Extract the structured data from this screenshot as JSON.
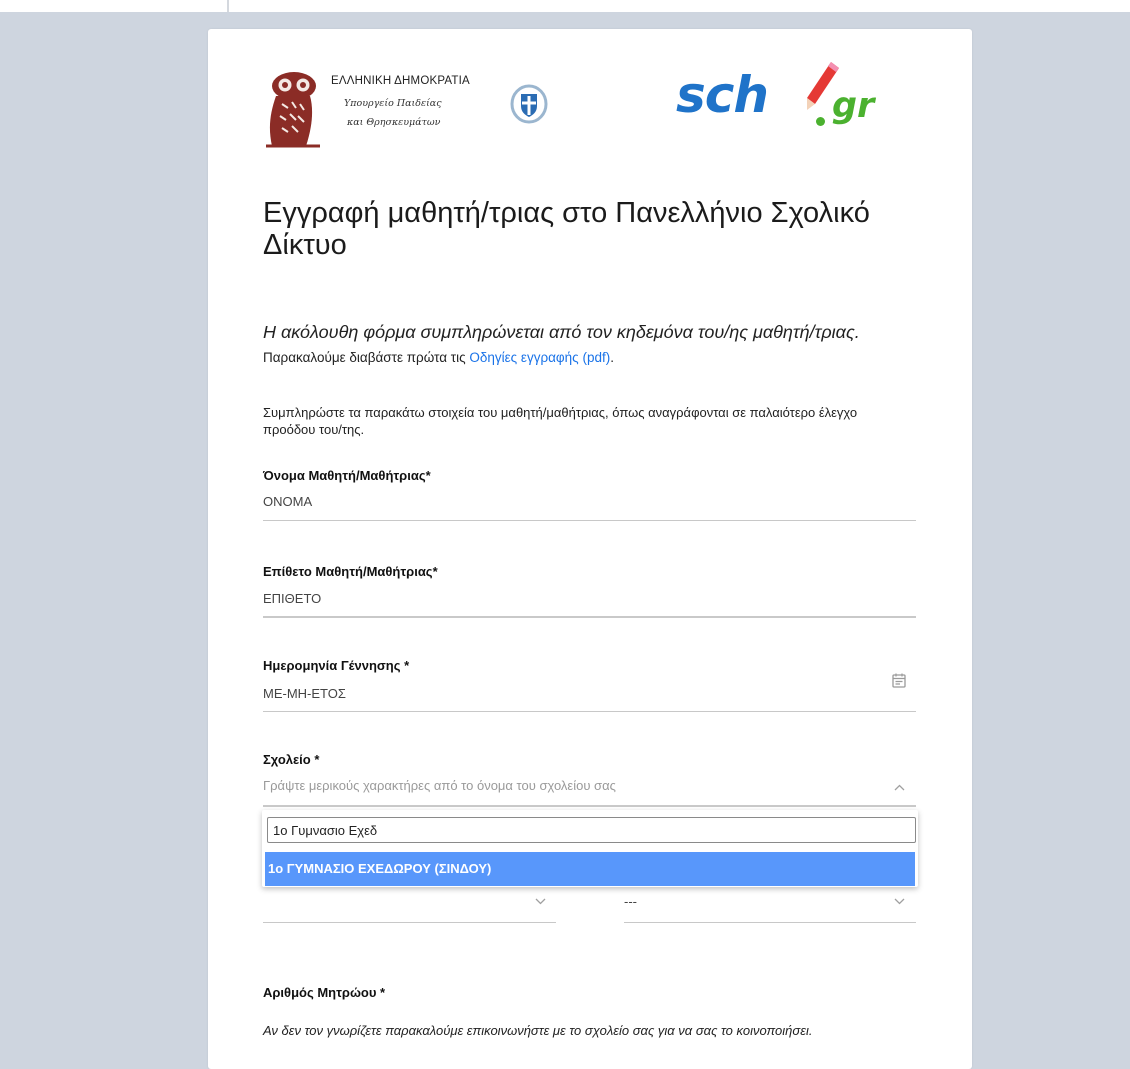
{
  "header": {
    "ministry_line1": "ΕΛΛΗΝΙΚΗ ΔΗΜΟΚΡΑΤΙΑ",
    "ministry_line2": "Υπουργείο Παιδείας",
    "ministry_line3": "και Θρησκευμάτων",
    "portal_logo_main": "sch",
    "portal_logo_suffix": "gr"
  },
  "page": {
    "title": "Εγγραφή μαθητή/τριας στο Πανελλήνιο Σχολικό Δίκτυο",
    "intro_italic": "Η ακόλουθη φόρμα συμπληρώνεται από τον κηδεμόνα του/ης μαθητή/τριας.",
    "intro_plain": " Παρακαλούμε διαβάστε πρώτα τις ",
    "intro_link": "Οδηγίες εγγραφής (pdf)",
    "intro_end": ".",
    "fill_note": "Συμπληρώστε τα παρακάτω στοιχεία του μαθητή/μαθήτριας, όπως αναγράφονται σε παλαιότερο έλεγχο προόδου του/της."
  },
  "form": {
    "first_name": {
      "label": "Όνομα Μαθητή/Μαθήτριας*",
      "value": "ΟΝΟΜΑ"
    },
    "last_name": {
      "label": "Επίθετο Μαθητή/Μαθήτριας*",
      "value": "ΕΠΙΘΕΤΟ"
    },
    "birth_date": {
      "label": "Ημερομηνία Γέννησης *",
      "value": "ΜΕ-ΜΗ-ΕΤΟΣ"
    },
    "school": {
      "label": "Σχολείο *",
      "placeholder": "Γράψτε μερικούς χαρακτήρες από το όνομα του σχολείου σας",
      "search_value": "1ο Γυμνασιο Εχεδ",
      "highlighted_option": "1ο ΓΥΜΝΑΣΙΟ ΕΧΕΔΩΡΟΥ (ΣΙΝΔΟΥ)"
    },
    "second_select_value": "---",
    "registry_number": {
      "label": "Αριθμός Μητρώου *",
      "help": "Αν δεν τον γνωρίζετε παρακαλούμε επικοινωνήστε με το σχολείο σας για να σας το κοινοποιήσει."
    }
  },
  "colors": {
    "page_background": "#ced5df",
    "link": "#1a73e8",
    "highlight": "#5897fb",
    "logo_blue": "#1f73c9",
    "logo_green": "#4bb12f",
    "owl_red": "#8b2c26"
  }
}
